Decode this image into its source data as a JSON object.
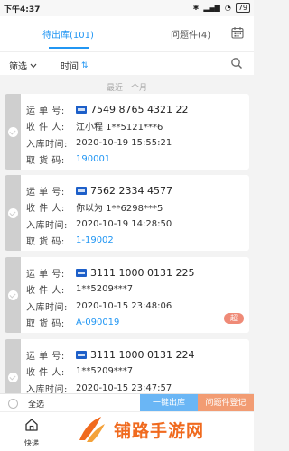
{
  "status_bar": {
    "time": "下午4:37",
    "battery": "79"
  },
  "tabs": [
    {
      "label": "待出库(101)",
      "active": true
    },
    {
      "label": "问题件(4)",
      "active": false
    }
  ],
  "filters": {
    "filter_label": "筛选",
    "time_label": "时间",
    "sort_icon": "⇅"
  },
  "section_label": "最近一个月",
  "labels": {
    "tracking": "运 单 号:",
    "recipient": "收 件 人:",
    "in_time": "入库时间:",
    "pickup_code": "取 货 码:"
  },
  "parcels": [
    {
      "tracking": "7549 8765 4321 22",
      "recipient": "江小程 1**5121***6",
      "in_time": "2020-10-19 15:55:21",
      "code": "190001",
      "overdue": ""
    },
    {
      "tracking": "7562 2334 4577",
      "recipient": "你以为 1**6298***5",
      "in_time": "2020-10-19 14:28:50",
      "code": "1-19002",
      "overdue": ""
    },
    {
      "tracking": "3111 1000 0131 225",
      "recipient": "1**5209***7",
      "in_time": "2020-10-15 23:48:06",
      "code": "A-090019",
      "overdue": "超"
    },
    {
      "tracking": "3111 1000 0131 224",
      "recipient": "1**5209***7",
      "in_time": "2020-10-15 23:47:57",
      "code": "",
      "overdue": ""
    }
  ],
  "bottom_bar": {
    "select_all": "全选",
    "one_click_out": "一键出库",
    "issue_register": "问题件登记"
  },
  "nav": {
    "label": "快递"
  },
  "watermark": {
    "text": "铺路手游网"
  },
  "colors": {
    "accent": "#2196f3",
    "orange": "#f29c73",
    "strip": "#cfcfcf"
  }
}
